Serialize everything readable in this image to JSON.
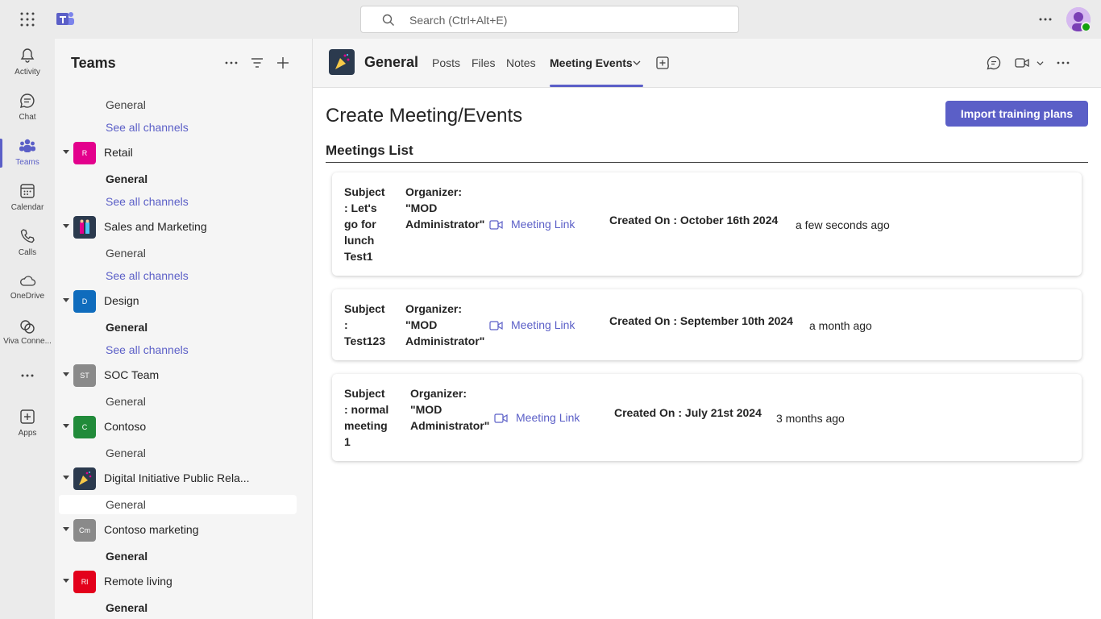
{
  "search": {
    "placeholder": "Search (Ctrl+Alt+E)"
  },
  "rail": {
    "items": [
      {
        "label": "Activity",
        "icon": "bell-icon"
      },
      {
        "label": "Chat",
        "icon": "chat-icon"
      },
      {
        "label": "Teams",
        "icon": "teams-icon"
      },
      {
        "label": "Calendar",
        "icon": "calendar-icon"
      },
      {
        "label": "Calls",
        "icon": "phone-icon"
      },
      {
        "label": "OneDrive",
        "icon": "cloud-icon"
      },
      {
        "label": "Viva Conne...",
        "icon": "viva-icon"
      },
      {
        "label": "Apps",
        "icon": "add-apps-icon"
      }
    ]
  },
  "pane": {
    "title": "Teams",
    "teams": [
      {
        "name": "Retail",
        "initials": "R",
        "color": "#e3008c"
      },
      {
        "name": "Sales and Marketing",
        "initials": "",
        "color": "#2b3a4e"
      },
      {
        "name": "Design",
        "initials": "D",
        "color": "#0f6cbd"
      },
      {
        "name": "SOC Team",
        "initials": "ST",
        "color": "#8a8a8a"
      },
      {
        "name": "Contoso",
        "initials": "C",
        "color": "#218b3a"
      },
      {
        "name": "Digital Initiative Public Rela...",
        "initials": "",
        "color": "#2b3a4e"
      },
      {
        "name": "Contoso marketing",
        "initials": "Cm",
        "color": "#8a8a8a"
      },
      {
        "name": "Remote living",
        "initials": "Rl",
        "color": "#e3001b"
      }
    ],
    "general_label": "General",
    "see_all_label": "See all channels"
  },
  "channel": {
    "title": "General",
    "tabs": [
      "Posts",
      "Files",
      "Notes",
      "Meeting Events"
    ]
  },
  "page": {
    "title": "Create Meeting/Events",
    "import_button": "Import training plans",
    "list_title": "Meetings List",
    "meetings": [
      {
        "subject_lines": [
          "Subject",
          ": Let's",
          "go for",
          "lunch",
          "Test1"
        ],
        "organizer_lines": [
          "Organizer:",
          "\"MOD",
          "Administrator\""
        ],
        "link_label": "Meeting Link",
        "created": "Created On : October 16th 2024",
        "ago": "a few seconds ago"
      },
      {
        "subject_lines": [
          "Subject",
          ":",
          "Test123"
        ],
        "organizer_lines": [
          "Organizer:",
          "\"MOD",
          "Administrator\""
        ],
        "link_label": "Meeting Link",
        "created": "Created On : September 10th 2024",
        "ago": "a month ago"
      },
      {
        "subject_lines": [
          "Subject",
          ": normal",
          "meeting",
          "1"
        ],
        "organizer_lines": [
          "Organizer:",
          "\"MOD",
          "Administrator\""
        ],
        "link_label": "Meeting Link",
        "created": "Created On : July 21st 2024",
        "ago": "3 months ago"
      }
    ]
  },
  "colors": {
    "accent": "#5b5fc7"
  }
}
